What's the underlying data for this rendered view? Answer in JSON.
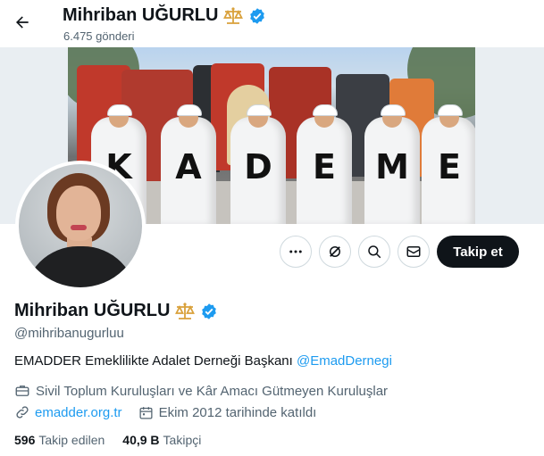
{
  "header": {
    "back_icon": "arrow-left-icon",
    "name": "Mihriban UĞURLU",
    "post_count": "6.475 gönderi"
  },
  "banner": {
    "letters": [
      "K",
      "A",
      "D",
      "E",
      "M",
      "E"
    ]
  },
  "actions": {
    "more_icon": "more-horizontal-icon",
    "grok_icon": "grok-icon",
    "search_icon": "search-icon",
    "message_icon": "envelope-icon",
    "follow_label": "Takip et"
  },
  "profile": {
    "name": "Mihriban UĞURLU",
    "handle": "@mihribanugurluu",
    "badges": [
      "scales-icon",
      "verified-badge-icon"
    ],
    "bio_text": "EMADDER Emeklilikte Adalet Derneği Başkanı ",
    "bio_mention": "@EmadDernegi",
    "category": "Sivil Toplum Kuruluşları ve Kâr Amacı Gütmeyen Kuruluşlar",
    "website": "emadder.org.tr",
    "joined": "Ekim 2012 tarihinde katıldı"
  },
  "stats": {
    "following_count": "596",
    "following_label": "Takip edilen",
    "followers_count": "40,9 B",
    "followers_label": "Takipçi"
  },
  "colors": {
    "accent": "#1d9bf0",
    "text": "#0f1419",
    "muted": "#536471",
    "scales": "#d9a13b"
  }
}
